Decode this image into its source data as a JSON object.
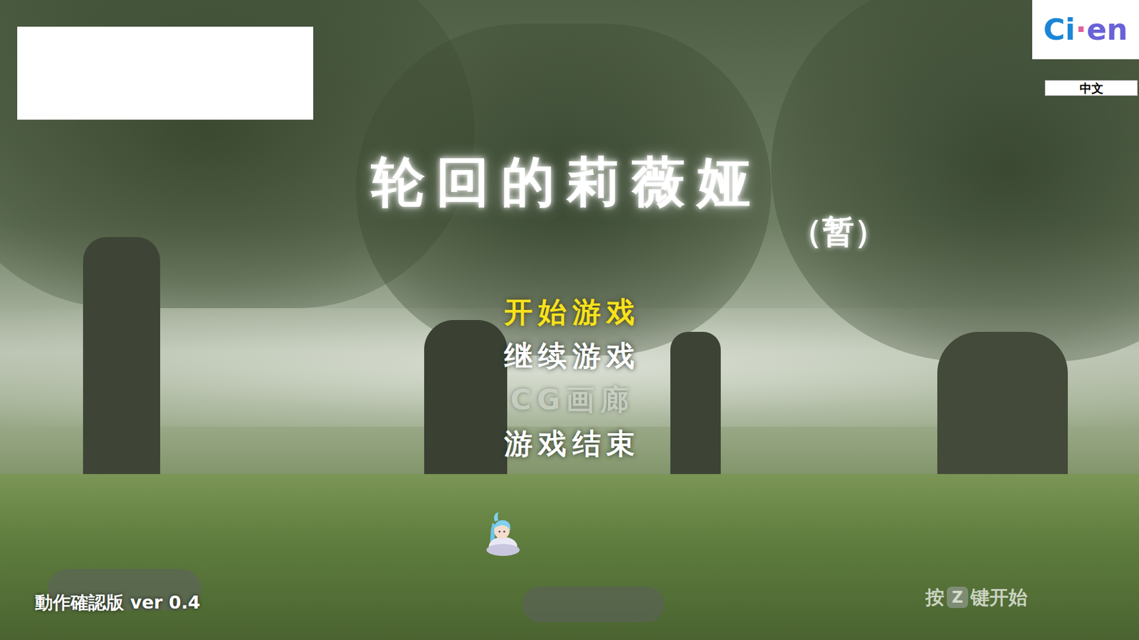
{
  "logo": {
    "parts": [
      {
        "text": "Ci",
        "color": "#1b86d6"
      },
      {
        "text": "·",
        "color": "#e0609a"
      },
      {
        "text": "en",
        "color": "#6a62d8"
      }
    ]
  },
  "language": {
    "label": "中文"
  },
  "title": "轮回的莉薇娅",
  "subtitle": "（暂）",
  "menu": [
    {
      "label": "开始游戏",
      "selected": true,
      "disabled": false
    },
    {
      "label": "继续游戏",
      "selected": false,
      "disabled": false
    },
    {
      "label": "CG画廊",
      "selected": false,
      "disabled": true
    },
    {
      "label": "游戏结束",
      "selected": false,
      "disabled": false
    }
  ],
  "version": "動作確認版 ver 0.4",
  "hint": {
    "before": "按",
    "key": "Z",
    "after": "键开始"
  }
}
